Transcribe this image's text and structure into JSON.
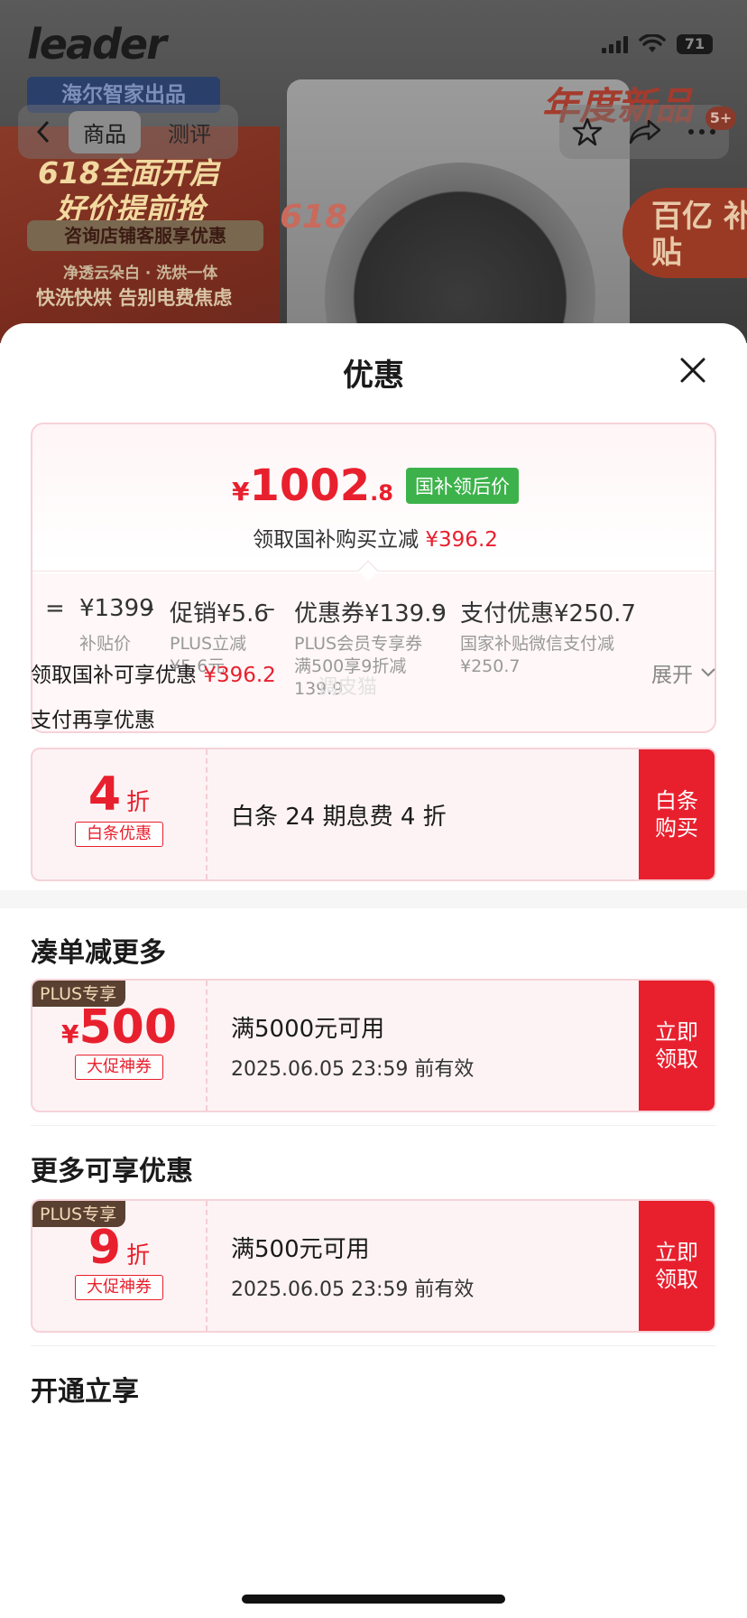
{
  "background": {
    "logo_text": "leader",
    "brand_tag": "海尔智家出品",
    "poster_line1": "618全面开启",
    "poster_line2": "好价提前抢",
    "poster_box": "咨询店铺客服享优惠",
    "poster_b1": "净透云朵白 · 洗烘一体",
    "poster_b2": "快洗快烘 告别电费焦虑",
    "badge_618": "618",
    "new_tag": "年度新品",
    "subsidy_tag": "百亿 补贴",
    "more_count": "5+"
  },
  "status_bar": {
    "battery": "71"
  },
  "nav": {
    "tabs": [
      {
        "label": "商品",
        "active": true
      },
      {
        "label": "测评",
        "active": false
      }
    ]
  },
  "sheet": {
    "title": "优惠",
    "price_card": {
      "yen": "¥",
      "price_int": "1002",
      "price_dec": ".8",
      "badge": "国补领后价",
      "sub_text": "领取国补购买立减",
      "sub_amount": "¥396.2",
      "breakdown": [
        {
          "op": "=",
          "value": "¥1399",
          "label": "补贴价"
        },
        {
          "op": "–",
          "value": "促销¥5.6",
          "label": "PLUS立减\n¥5.6元"
        },
        {
          "op": "–",
          "value": "优惠券¥139.9",
          "label": "PLUS会员专享券\n满500享9折减\n139.9"
        },
        {
          "op": "–",
          "value": "支付优惠¥250.7",
          "label": "国家补贴微信支付减\n¥250.7"
        }
      ]
    },
    "gov_row": {
      "text": "领取国补可享优惠",
      "amount": "¥396.2",
      "expand": "展开"
    },
    "watermark": "调皮猫",
    "pay_row": "支付再享优惠",
    "baitiao": {
      "big": "4",
      "unit": "折",
      "tag": "白条优惠",
      "title": "白条 24 期息费 4 折",
      "cta": "白条购买"
    },
    "section_more": "凑单减更多",
    "coupon_500": {
      "plus": "PLUS专享",
      "yen": "¥",
      "big": "500",
      "tag": "大促神券",
      "title": "满5000元可用",
      "date": "2025.06.05 23:59 前有效",
      "cta": "立即领取"
    },
    "section_more2": "更多可享优惠",
    "coupon_9": {
      "plus": "PLUS专享",
      "big": "9",
      "unit": "折",
      "tag": "大促神券",
      "title": "满500元可用",
      "date": "2025.06.05 23:59 前有效",
      "cta": "立即领取"
    },
    "section_open": "开通立享"
  },
  "colors": {
    "accent": "#e8202e",
    "green_badge": "#3db24b",
    "plus_badge": "#5a4030"
  }
}
